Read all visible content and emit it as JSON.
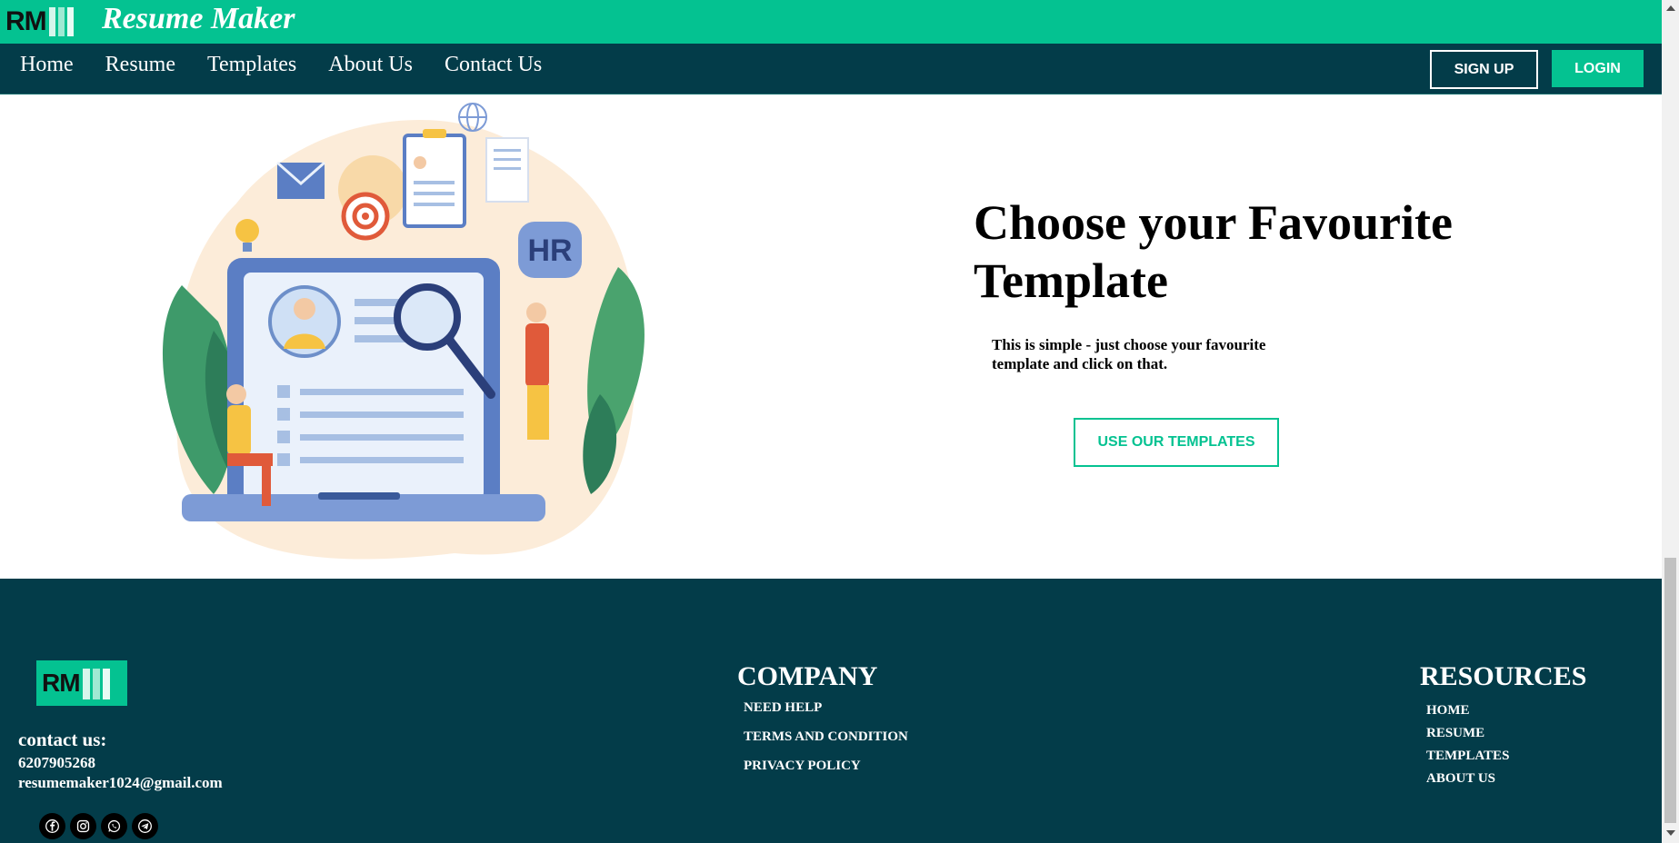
{
  "brand": {
    "logo_text": "RM",
    "title": "Resume Maker"
  },
  "nav": {
    "links": [
      "Home",
      "Resume",
      "Templates",
      "About Us",
      "Contact Us"
    ],
    "signup_label": "SIGN UP",
    "login_label": "LOGIN"
  },
  "hero": {
    "title": "Choose your Favourite Template",
    "text": "This is simple - just choose your favourite template and click on that.",
    "button_label": "USE OUR TEMPLATES",
    "illustration_badge": "HR"
  },
  "footer": {
    "logo_text": "RM",
    "contact_heading": "contact us:",
    "phone": "6207905268",
    "email": "resumemaker1024@gmail.com",
    "socials": [
      "facebook-icon",
      "instagram-icon",
      "whatsapp-icon",
      "telegram-icon"
    ],
    "company": {
      "heading": "COMPANY",
      "items": [
        "NEED HELP",
        "TERMS AND CONDITION",
        "PRIVACY POLICY"
      ]
    },
    "resources": {
      "heading": "RESOURCES",
      "items": [
        "HOME",
        "RESUME",
        "TEMPLATES",
        "ABOUT US"
      ]
    }
  },
  "colors": {
    "accent": "#04c291",
    "navy": "#033c49"
  }
}
